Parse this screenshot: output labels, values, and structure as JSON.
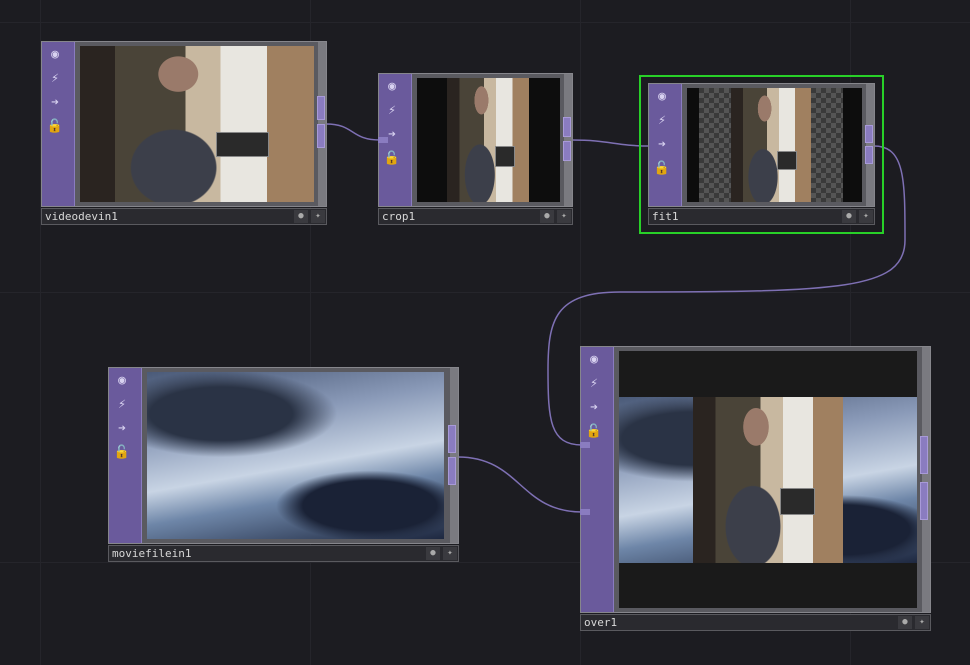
{
  "nodes": {
    "videodevin1": {
      "name": "videodevin1"
    },
    "crop1": {
      "name": "crop1"
    },
    "fit1": {
      "name": "fit1",
      "selected": true
    },
    "moviefilein1": {
      "name": "moviefilein1"
    },
    "over1": {
      "name": "over1"
    }
  },
  "icons": {
    "viewer": "eye-icon",
    "bypass": "bypass-icon",
    "display": "arrow-right-icon",
    "lock": "lock-icon",
    "flag_a": "dot-icon",
    "flag_b": "plus-icon"
  },
  "colors": {
    "background": "#1c1c21",
    "operator_strip": "#6a5a9c",
    "wire": "#8a7cc0",
    "selection": "#28d028"
  }
}
